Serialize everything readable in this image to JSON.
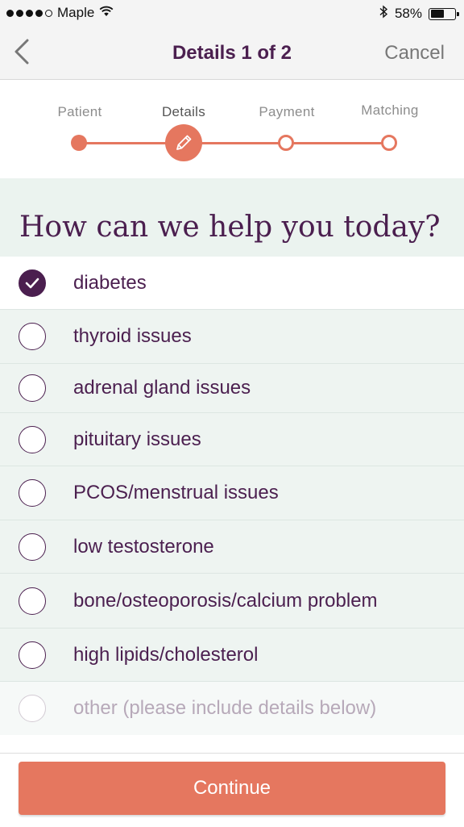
{
  "status_bar": {
    "carrier": "Maple",
    "battery_percent": "58%",
    "battery_level": 0.58
  },
  "nav": {
    "title": "Details 1 of 2",
    "cancel_label": "Cancel",
    "back_icon": "chevron-left-icon"
  },
  "stepper": {
    "steps": [
      {
        "label": "Patient",
        "state": "done"
      },
      {
        "label": "Details",
        "state": "active"
      },
      {
        "label": "Payment",
        "state": "future"
      },
      {
        "label": "Matching",
        "state": "future"
      }
    ]
  },
  "question": {
    "title": "How can we help you today?"
  },
  "options": [
    {
      "label": "diabetes",
      "checked": true
    },
    {
      "label": "thyroid issues",
      "checked": false
    },
    {
      "label": "adrenal gland issues",
      "checked": false
    },
    {
      "label": "pituitary issues",
      "checked": false
    },
    {
      "label": "PCOS/menstrual issues",
      "checked": false
    },
    {
      "label": "low testosterone",
      "checked": false
    },
    {
      "label": "bone/osteoporosis/calcium problem",
      "checked": false
    },
    {
      "label": "high lipids/cholesterol",
      "checked": false
    },
    {
      "label": "other (please include details below)",
      "checked": false
    }
  ],
  "footer": {
    "continue_label": "Continue"
  },
  "colors": {
    "accent": "#e5775f",
    "primary_text": "#4b1f4f",
    "section_bg": "#ebf3ef"
  }
}
